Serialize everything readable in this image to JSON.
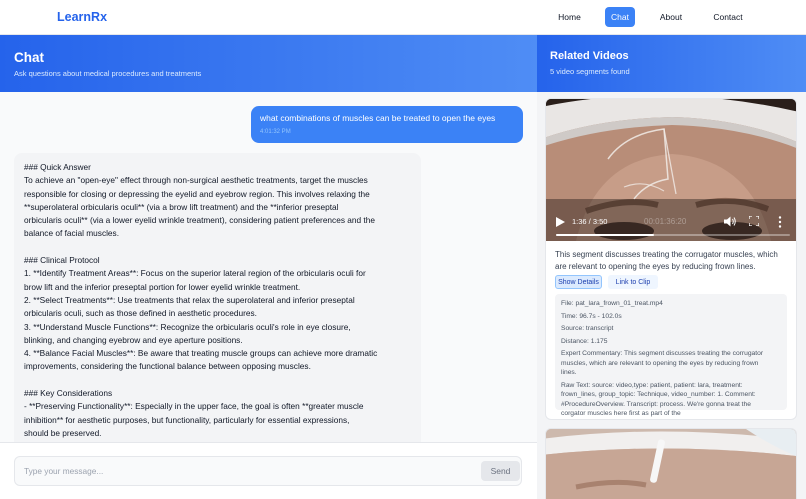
{
  "nav": {
    "brand": "LearnRx",
    "links": [
      "Home",
      "Chat",
      "About",
      "Contact"
    ],
    "active": "Chat"
  },
  "chat": {
    "title": "Chat",
    "subtitle": "Ask questions about medical procedures and treatments",
    "user_message": {
      "text": "what combinations of muscles can be treated to open the eyes",
      "time": "4:01:32 PM"
    },
    "bot_lines": [
      "### Quick Answer",
      "To achieve an \"open-eye\" effect through non-surgical aesthetic treatments, target the muscles",
      "responsible for closing or depressing the eyelid and eyebrow region. This involves relaxing the",
      "**superolateral orbicularis oculi** (via a brow lift treatment) and the **inferior preseptal",
      "orbicularis oculi** (via a lower eyelid wrinkle treatment), considering patient preferences and the",
      "balance of facial muscles.",
      "",
      "### Clinical Protocol",
      "1. **Identify Treatment Areas**: Focus on the superior lateral region of the orbicularis oculi for",
      "brow lift and the inferior preseptal portion for lower eyelid wrinkle treatment.",
      "2. **Select Treatments**: Use treatments that relax the superolateral and inferior preseptal",
      "orbicularis oculi, such as those defined in aesthetic procedures.",
      "3. **Understand Muscle Functions**: Recognize the orbicularis oculi's role in eye closure,",
      "blinking, and changing eyebrow and eye aperture positions.",
      "4. **Balance Facial Muscles**: Be aware that treating muscle groups can achieve more dramatic",
      "improvements, considering the functional balance between opposing muscles.",
      "",
      "### Key Considerations",
      "- **Preserving Functionality**: Especially in the upper face, the goal is often **greater muscle",
      "inhibition** for aesthetic purposes, but functionality, particularly for essential expressions,",
      "should be preserved."
    ],
    "input_placeholder": "Type your message...",
    "send_label": "Send"
  },
  "videos": {
    "title": "Related Videos",
    "count_text": "5 video segments found",
    "items": [
      {
        "time_display": "1:36 / 3:50",
        "overlay_time": "00:01:36:20",
        "progress": 0.417,
        "description": "This segment discusses treating the corrugator muscles, which are relevant to opening the eyes by reducing frown lines.",
        "show_details_label": "Show Details",
        "link_label": "Link to Clip",
        "details": [
          "File: pat_lara_frown_01_treat.mp4",
          "Time: 96.7s - 102.0s",
          "Source: transcript",
          "Distance: 1.175",
          "Expert Commentary: This segment discusses treating the corrugator",
          "muscles, which are relevant to opening the eyes by reducing frown",
          "lines.",
          "Raw Text: source: video,type: patient, patient: lara, treatment:",
          "frown_lines, group_topic: Technique, video_number: 1. Comment:",
          "#ProcedureOverview. Transcript: process. We're gonna treat the",
          "corgator muscles here first as part of the"
        ]
      }
    ]
  },
  "colors": {
    "accent": "#3b82f6",
    "header_gradient_start": "#2563eb",
    "header_gradient_end": "#4f8df5",
    "brand": "#2563eb"
  },
  "icons": [
    "play-icon",
    "volume-icon",
    "fullscreen-icon",
    "more-options-icon"
  ]
}
